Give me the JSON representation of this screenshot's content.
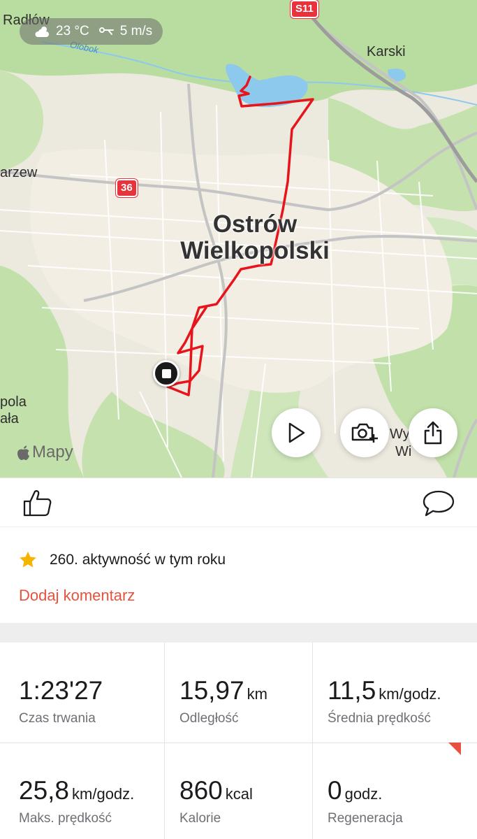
{
  "map": {
    "weather": {
      "temperature": "23 °C",
      "wind": "5 m/s"
    },
    "labels": {
      "radlow": "Radłów",
      "karski": "Karski",
      "parzew": "arzew",
      "opola_1": "pola",
      "opola_2": "ała",
      "wysocko_1": "Wy",
      "wysocko_2": "Wi",
      "river": "Olobok",
      "city_line1": "Ostrów",
      "city_line2": "Wielkopolski"
    },
    "road_badges": {
      "s11": "S11",
      "r36": "36"
    },
    "attribution": "Mapy",
    "route_color": "#e8141c"
  },
  "actions": {
    "like_icon": "thumbs-up-icon",
    "comment_icon": "speech-bubble-icon"
  },
  "info": {
    "achievement_text": "260. aktywność w tym roku",
    "comment_link": "Dodaj komentarz"
  },
  "stats": [
    {
      "value": "1:23'27",
      "unit": "",
      "label": "Czas trwania"
    },
    {
      "value": "15,97",
      "unit": "km",
      "label": "Odległość"
    },
    {
      "value": "11,5",
      "unit": "km/godz.",
      "label": "Średnia prędkość"
    },
    {
      "value": "25,8",
      "unit": "km/godz.",
      "label": "Maks. prędkość"
    },
    {
      "value": "860",
      "unit": "kcal",
      "label": "Kalorie"
    },
    {
      "value": "0",
      "unit": "godz.",
      "label": "Regeneracja"
    }
  ],
  "colors": {
    "accent": "#e8513e",
    "star": "#f4b400"
  }
}
